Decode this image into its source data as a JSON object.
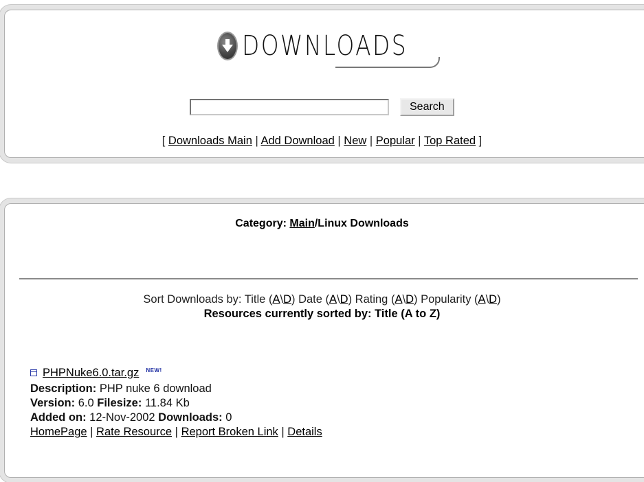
{
  "header": {
    "logo_text": "DOWNLOADS",
    "search": {
      "value": "",
      "placeholder": "",
      "button_label": "Search"
    },
    "nav": {
      "open_bracket": "[",
      "close_bracket": "]",
      "separator": "|",
      "items": [
        {
          "label": "Downloads Main"
        },
        {
          "label": "Add Download"
        },
        {
          "label": "New"
        },
        {
          "label": "Popular"
        },
        {
          "label": "Top Rated"
        }
      ]
    }
  },
  "category": {
    "prefix": "Category:",
    "main_link": "Main",
    "path_rest": "/Linux Downloads"
  },
  "sort": {
    "prefix": "Sort Downloads by:",
    "options": [
      {
        "label": "Title",
        "asc": "A",
        "desc": "D"
      },
      {
        "label": "Date",
        "asc": "A",
        "desc": "D"
      },
      {
        "label": "Rating",
        "asc": "A",
        "desc": "D"
      },
      {
        "label": "Popularity",
        "asc": "A",
        "desc": "D"
      }
    ],
    "slash": "\\",
    "current": "Resources currently sorted by: Title (A to Z)"
  },
  "entry": {
    "title": "PHPNuke6.0.tar.gz",
    "badge": "NEW!",
    "description_label": "Description:",
    "description": "PHP nuke 6 download",
    "version_label": "Version:",
    "version": "6.0",
    "filesize_label": "Filesize:",
    "filesize": "11.84 Kb",
    "added_label": "Added on:",
    "added": "12-Nov-2002",
    "downloads_label": "Downloads:",
    "downloads": "0",
    "actions": [
      "HomePage",
      "Rate Resource",
      "Report Broken Link",
      "Details"
    ]
  },
  "colors": {
    "panel_border": "#c9c9c9",
    "icon_blue": "#2a3aa8"
  }
}
